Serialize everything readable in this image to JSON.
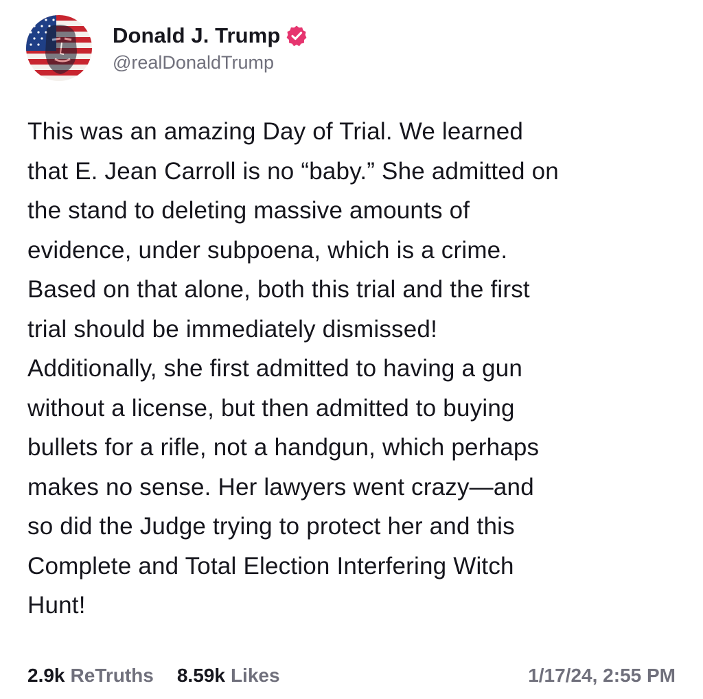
{
  "post": {
    "author": {
      "display_name": "Donald J. Trump",
      "handle": "@realDonaldTrump",
      "verified": true
    },
    "body_lines": [
      "This was an amazing Day of Trial. We learned",
      "that E. Jean Carroll is no “baby.” She admitted on",
      "the stand to deleting massive amounts of",
      "evidence, under subpoena, which is a crime.",
      "Based on that alone, both this trial and the first",
      "trial should be immediately dismissed!",
      "Additionally, she first admitted to having a gun",
      "without a license, but then admitted to buying",
      "bullets for a rifle, not a handgun, which perhaps",
      "makes no sense. Her lawyers went crazy—and",
      "so did the Judge trying to protect her and this",
      "Complete and Total Election Interfering Witch",
      "Hunt!"
    ],
    "stats": {
      "retruths_count": "2.9k",
      "retruths_label": "ReTruths",
      "likes_count": "8.59k",
      "likes_label": "Likes"
    },
    "timestamp": "1/17/24, 2:55 PM"
  },
  "icons": {
    "avatar": "flag-portrait-avatar",
    "verified": "verified-badge-icon"
  },
  "colors": {
    "text_primary": "#16161d",
    "text_secondary": "#70707c",
    "verified_badge": "#e6356f",
    "background": "#ffffff"
  }
}
